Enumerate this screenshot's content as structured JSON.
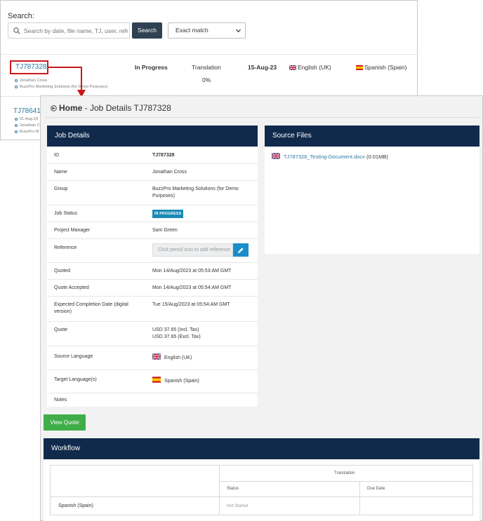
{
  "search": {
    "label": "Search:",
    "placeholder": "Search by date, file name, TJ, user, reference",
    "button": "Search",
    "match_mode": "Exact match"
  },
  "jobs": [
    {
      "id": "TJ787328",
      "status": "In Progress",
      "service": "Translation",
      "progress": "0%",
      "date": "15-Aug-23",
      "source_language": "English (UK)",
      "target_language": "Spanish (Spain)",
      "meta": [
        "Jonathan Cross",
        "BuzzPro Marketing Solutions (for Demo Purposes)"
      ]
    },
    {
      "id": "TJ78641",
      "meta": [
        "01-Aug-23",
        "Jonathan C",
        "BuzzPro M"
      ]
    }
  ],
  "details_page": {
    "breadcrumb_home": "Home",
    "breadcrumb_rest": " - Job Details TJ787328",
    "job_details_title": "Job Details",
    "source_files_title": "Source Files",
    "rows": {
      "id_label": "ID",
      "id_value": "TJ787328",
      "name_label": "Name",
      "name_value": "Jonathan Cross",
      "group_label": "Group",
      "group_value": "BuzzPro Marketing Solutions (for Demo Purposes)",
      "status_label": "Job Status",
      "status_value": "IN PROGRESS",
      "pm_label": "Project Manager",
      "pm_value": "Sam Green",
      "ref_label": "Reference",
      "ref_placeholder": "Click pencil icon to add reference",
      "quoted_label": "Quoted",
      "quoted_value": "Mon 14/Aug/2023 at 05:53:AM GMT",
      "accepted_label": "Quote Accepted",
      "accepted_value": "Mon 14/Aug/2023 at 05:54:AM GMT",
      "ecd_label": "Expected Completion Date (digital version)",
      "ecd_value": "Tue 15/Aug/2023 at 05:54:AM GMT",
      "quote_label": "Quote",
      "quote_incl": "USD 37.65 (Incl. Tax)",
      "quote_excl": "USD 37.65 (Excl. Tax)",
      "src_label": "Source Language",
      "src_value": "English (UK)",
      "tgt_label": "Target Language(s)",
      "tgt_value": "Spanish (Spain)",
      "notes_label": "Notes"
    },
    "source_file_name": "TJ787328_Testing-Document.docx",
    "source_file_size": " (0.01MB)",
    "view_quote_button": "View Quote",
    "workflow": {
      "title": "Workflow",
      "group_header": "Translation",
      "col_status": "Status",
      "col_due": "Due Date",
      "row_language": "Spanish (Spain)",
      "row_status": "Not Started"
    }
  },
  "colors": {
    "navy_header": "#102a4c",
    "link_blue": "#2d7aa5",
    "badge_blue": "#1a8ab5",
    "view_quote_green": "#3fae49",
    "highlight_red": "#cc1a1a"
  }
}
